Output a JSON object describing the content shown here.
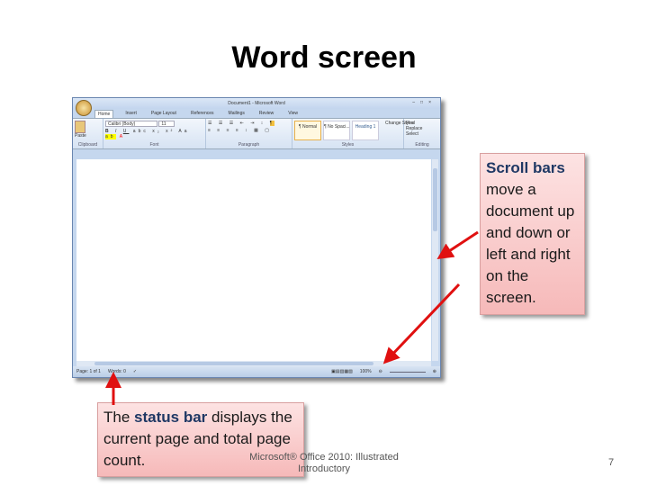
{
  "slide": {
    "title": "Word screen",
    "footer": "Microsoft® Office 2010: Illustrated Introductory",
    "page_number": "7"
  },
  "word": {
    "window_title": "Document1 - Microsoft Word",
    "tabs": [
      "Home",
      "Insert",
      "Page Layout",
      "References",
      "Mailings",
      "Review",
      "View"
    ],
    "groups": {
      "clipboard": "Clipboard",
      "font": "Font",
      "paragraph": "Paragraph",
      "styles": "Styles",
      "editing": "Editing"
    },
    "paste": "Paste",
    "font_name": "Calibri (Body)",
    "font_size": "11",
    "styles": [
      "¶ Normal",
      "¶ No Spaci...",
      "Heading 1"
    ],
    "change_styles": "Change Styles",
    "editing": [
      "Find",
      "Replace",
      "Select"
    ],
    "status": {
      "page": "Page: 1 of 1",
      "words": "Words: 0",
      "zoom": "100%"
    }
  },
  "callouts": {
    "scroll": {
      "bold": "Scroll bars",
      "text": " move a document up and down or left and right on the screen."
    },
    "status": {
      "pre": "The ",
      "bold": "status bar",
      "text": " displays the current page and total page count."
    }
  },
  "colors": {
    "arrow": "#e01010",
    "callout": "#f6b9b9"
  }
}
